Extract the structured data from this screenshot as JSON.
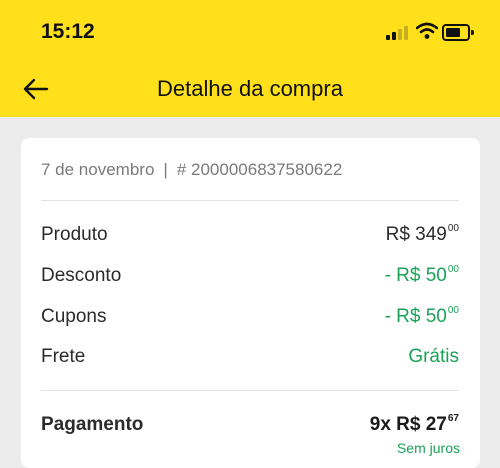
{
  "status_bar": {
    "time": "15:12"
  },
  "header": {
    "title": "Detalhe da compra"
  },
  "order": {
    "date": "7 de novembro",
    "separator": "|",
    "id": "# 2000006837580622"
  },
  "summary": {
    "rows": [
      {
        "label": "Produto",
        "main": "R$ 349",
        "cents": "00",
        "color": "dark"
      },
      {
        "label": "Desconto",
        "main": "- R$ 50",
        "cents": "00",
        "color": "green"
      },
      {
        "label": "Cupons",
        "main": "- R$ 50",
        "cents": "00",
        "color": "green"
      },
      {
        "label": "Frete",
        "main": "Grátis",
        "cents": "",
        "color": "green"
      }
    ]
  },
  "payment": {
    "label": "Pagamento",
    "installments": "9x R$ 27",
    "cents": "67",
    "note": "Sem juros"
  },
  "colors": {
    "accent": "#ffe01b",
    "positive": "#1aa357"
  }
}
